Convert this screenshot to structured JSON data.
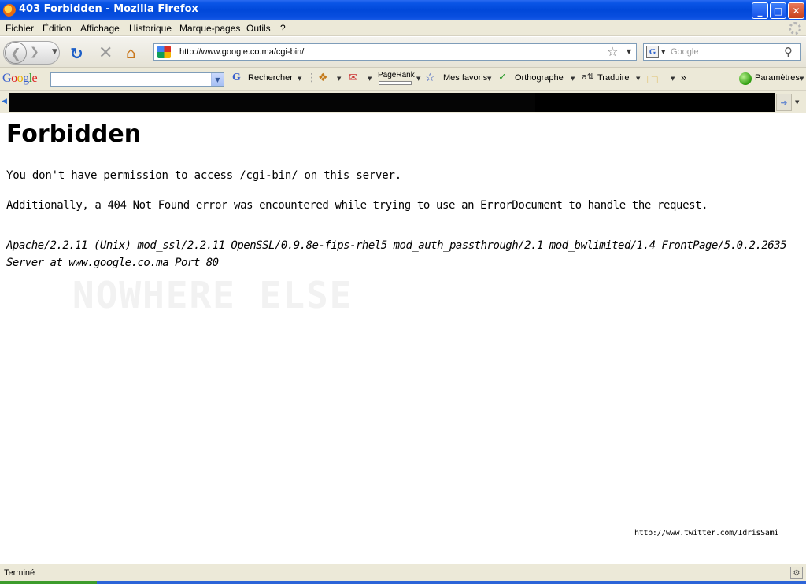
{
  "window": {
    "title": "403 Forbidden - Mozilla Firefox",
    "controls": {
      "minimize": "_",
      "maximize": "□",
      "close": "✕"
    }
  },
  "menubar": {
    "items": [
      "Fichier",
      "Édition",
      "Affichage",
      "Historique",
      "Marque-pages",
      "Outils",
      "?"
    ]
  },
  "navbar": {
    "url": "http://www.google.co.ma/cgi-bin/",
    "search_placeholder": "Google",
    "search_engine_glyph": "G"
  },
  "google_toolbar": {
    "logo": [
      "G",
      "o",
      "o",
      "g",
      "l",
      "e"
    ],
    "rechercher": "Rechercher",
    "pagerank": "PageRank",
    "mes_favoris": "Mes favoris",
    "orthographe": "Orthographe",
    "traduire": "Traduire",
    "more": "»",
    "parametres": "Paramètres"
  },
  "page": {
    "heading": "Forbidden",
    "message": "You don't have permission to access /cgi-bin/ on this server.",
    "additional": "Additionally, a 404 Not Found error was encountered while trying to use an ErrorDocument to handle the request.",
    "address": "Apache/2.2.11 (Unix) mod_ssl/2.2.11 OpenSSL/0.9.8e-fips-rhel5 mod_auth_passthrough/2.1 mod_bwlimited/1.4 FrontPage/5.0.2.2635 Server at www.google.co.ma Port 80",
    "watermark": "NOWHERE ELSE",
    "credit": "http://www.twitter.com/IdrisSami"
  },
  "statusbar": {
    "text": "Terminé"
  },
  "icons": {
    "back": "back-arrow-icon",
    "forward": "forward-arrow-icon",
    "reload": "reload-icon",
    "stop": "stop-icon",
    "home": "home-icon",
    "bookmark_star": "star-icon",
    "search_go": "magnifier-icon"
  },
  "colors": {
    "titlebar": "#0048d9",
    "chrome": "#ece9d8",
    "reload": "#1d5fc7",
    "status_ok": "#2f9d10"
  }
}
